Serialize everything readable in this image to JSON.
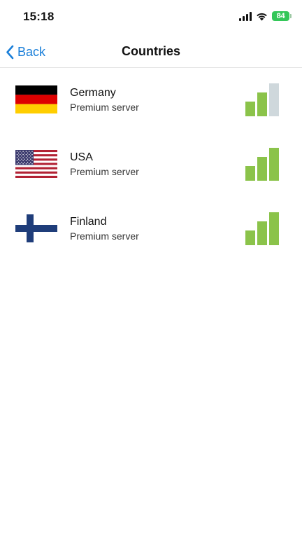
{
  "status_bar": {
    "time": "15:18",
    "battery_percent": "84"
  },
  "nav": {
    "back_label": "Back",
    "title": "Countries"
  },
  "countries": [
    {
      "name": "Germany",
      "subtitle": "Premium server",
      "flag_icon": "germany-flag-icon",
      "signal_level": 2,
      "signal_max": 3
    },
    {
      "name": "USA",
      "subtitle": "Premium server",
      "flag_icon": "usa-flag-icon",
      "signal_level": 3,
      "signal_max": 3
    },
    {
      "name": "Finland",
      "subtitle": "Premium server",
      "flag_icon": "finland-flag-icon",
      "signal_level": 3,
      "signal_max": 3
    }
  ],
  "colors": {
    "accent": "#1a7fd9",
    "signal_on": "#8bc34a",
    "signal_off": "#cfd8dc",
    "battery": "#34c759"
  }
}
